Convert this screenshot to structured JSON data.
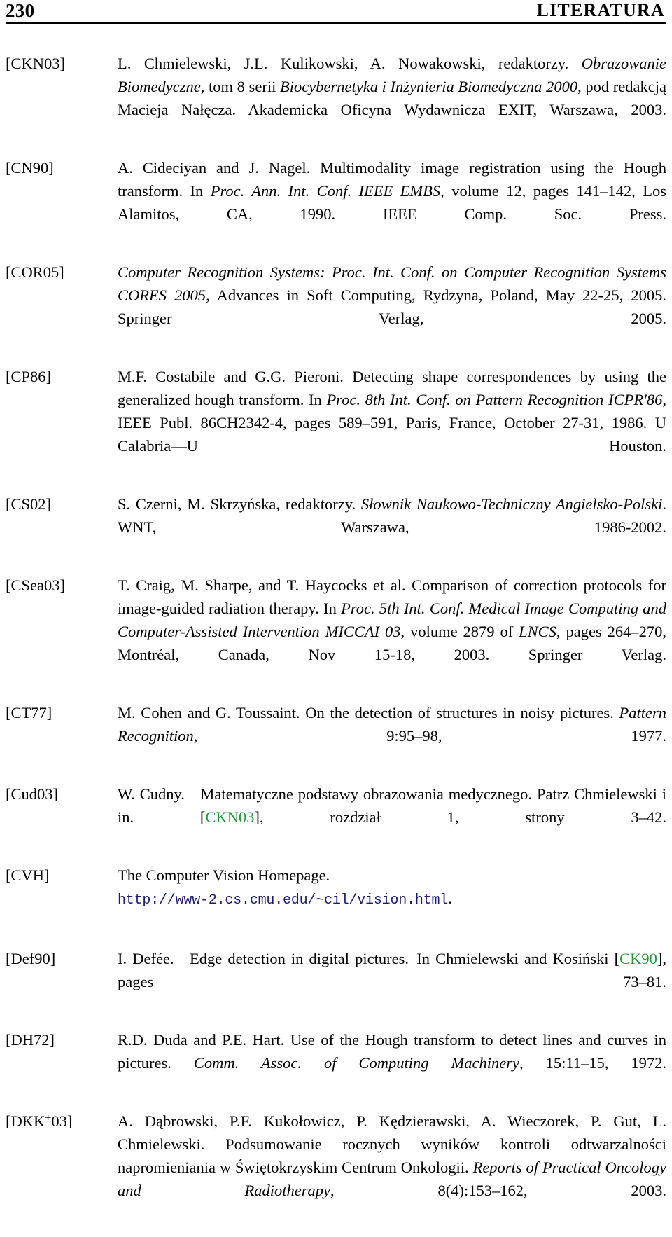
{
  "header": {
    "folio": "230",
    "title": "LITERATURA"
  },
  "colors": {
    "text": "#000000",
    "citation_link": "#1f9b33",
    "url_link": "#1c1c78",
    "rule": "#000000",
    "background": "#ffffff"
  },
  "bibliography": {
    "entries": [
      {
        "label": "[CKN03]",
        "text": "L. Chmielewski, J.L. Kulikowski, A. Nowakowski, redaktorzy. Obrazowanie Biomedyczne, tom 8 serii Biocybernetyka i Inżynieria Biomedyczna 2000, pod redakcją Macieja Nałęcza. Akademicka Oficyna Wydawnicza EXIT, Warszawa, 2003.",
        "parts": [
          {
            "t": "L. Chmielewski, J.L. Kulikowski, A. Nowakowski, redaktorzy. ",
            "s": "roman"
          },
          {
            "t": "Obrazowanie Biomedyczne",
            "s": "italic"
          },
          {
            "t": ", tom 8 serii ",
            "s": "roman"
          },
          {
            "t": "Biocybernetyka i Inżynieria Biomedyczna 2000",
            "s": "italic"
          },
          {
            "t": ", pod redakcją Macieja Nałęcza. Akademicka Oficyna Wydawnicza EXIT, Warszawa, 2003.",
            "s": "roman"
          }
        ]
      },
      {
        "label": "[CN90]",
        "text": "A. Cideciyan and J. Nagel. Multimodality image registration using the Hough transform. In Proc. Ann. Int. Conf. IEEE EMBS, volume 12, pages 141–142, Los Alamitos, CA, 1990. IEEE Comp. Soc. Press.",
        "parts": [
          {
            "t": "A. Cideciyan and J. Nagel. Multimodality image registration using the Hough transform. In ",
            "s": "roman"
          },
          {
            "t": "Proc. Ann. Int. Conf. IEEE EMBS",
            "s": "italic"
          },
          {
            "t": ", volume 12, pages 141–142, Los Alamitos, CA, 1990. IEEE Comp. Soc. Press.",
            "s": "roman"
          }
        ]
      },
      {
        "label": "[COR05]",
        "text": "Computer Recognition Systems: Proc. Int. Conf. on Computer Recognition Systems CORES 2005, Advances in Soft Computing, Rydzyna, Poland, May 22-25, 2005. Springer Verlag, 2005.",
        "parts": [
          {
            "t": "Computer Recognition Systems: Proc. Int. Conf. on Computer Recognition Systems CORES 2005",
            "s": "italic"
          },
          {
            "t": ", Advances in Soft Computing, Rydzyna, Poland, May 22-25, 2005. Springer Verlag, 2005.",
            "s": "roman"
          }
        ]
      },
      {
        "label": "[CP86]",
        "text": "M.F. Costabile and G.G. Pieroni. Detecting shape correspondences by using the generalized hough transform. In Proc. 8th Int. Conf. on Pattern Recognition ICPR'86, IEEE Publ. 86CH2342-4, pages 589–591, Paris, France, October 27-31, 1986. U Calabria—U Houston.",
        "parts": [
          {
            "t": "M.F. Costabile and G.G. Pieroni. Detecting shape correspondences by using the generalized hough transform. In ",
            "s": "roman"
          },
          {
            "t": "Proc. 8th Int. Conf. on Pattern Recognition ICPR'86",
            "s": "italic"
          },
          {
            "t": ", IEEE Publ. 86CH2342-4, pages 589–591, Paris, France, October 27-31, 1986. U Calabria—U Houston.",
            "s": "roman"
          }
        ]
      },
      {
        "label": "[CS02]",
        "text": "S. Czerni, M. Skrzyńska, redaktorzy. Słownik Naukowo-Techniczny Angielsko-Polski. WNT, Warszawa, 1986-2002.",
        "parts": [
          {
            "t": "S. Czerni, M. Skrzyńska, redaktorzy. ",
            "s": "roman"
          },
          {
            "t": "Słownik Naukowo-Techniczny Angielsko-Polski",
            "s": "italic"
          },
          {
            "t": ". WNT, Warszawa, 1986-2002.",
            "s": "roman"
          }
        ]
      },
      {
        "label": "[CSea03]",
        "text": "T. Craig, M. Sharpe, and T. Haycocks et al. Comparison of correction protocols for image-guided radiation therapy. In Proc. 5th Int. Conf. Medical Image Computing and Computer-Assisted Intervention MICCAI 03, volume 2879 of LNCS, pages 264–270, Montréal, Canada, Nov 15-18, 2003. Springer Verlag.",
        "parts": [
          {
            "t": "T. Craig, M. Sharpe, and T. Haycocks et al. Comparison of correction protocols for image-guided radiation therapy. In ",
            "s": "roman"
          },
          {
            "t": "Proc. 5th Int. Conf. Medical Image Computing and Computer-Assisted Intervention MICCAI 03",
            "s": "italic"
          },
          {
            "t": ", volume 2879 of ",
            "s": "roman"
          },
          {
            "t": "LNCS",
            "s": "italic"
          },
          {
            "t": ", pages 264–270, Montréal, Canada, Nov 15-18, 2003. Springer Verlag.",
            "s": "roman"
          }
        ]
      },
      {
        "label": "[CT77]",
        "text": "M. Cohen and G. Toussaint. On the detection of structures in noisy pictures. Pattern Recognition, 9:95–98, 1977.",
        "parts": [
          {
            "t": "M. Cohen and G. Toussaint. On the detection of structures in noisy pictures. ",
            "s": "roman"
          },
          {
            "t": "Pattern Recognition",
            "s": "italic"
          },
          {
            "t": ", 9:95–98, 1977.",
            "s": "roman"
          }
        ]
      },
      {
        "label": "[Cud03]",
        "text": "W. Cudny. Matematyczne podstawy obrazowania medycznego. Patrz Chmielewski i in. [CKN03], rozdział 1, strony 3–42.",
        "parts": [
          {
            "t": "W. Cudny. Matematyczne podstawy obrazowania medycznego. Patrz Chmielewski i in. [",
            "s": "roman"
          },
          {
            "t": "CKN03",
            "s": "cite"
          },
          {
            "t": "], rozdział 1, strony 3–42.",
            "s": "roman"
          }
        ]
      },
      {
        "label": "[CVH]",
        "text": "The Computer Vision Homepage. http://www-2.cs.cmu.edu/~cil/vision.html.",
        "parts": [
          {
            "t": "The Computer Vision Homepage.",
            "s": "roman"
          },
          {
            "t": "BREAK",
            "s": "break"
          },
          {
            "t": "http://www-2.cs.cmu.edu/~cil/vision.html",
            "s": "url"
          },
          {
            "t": ".",
            "s": "roman"
          }
        ]
      },
      {
        "label": "[Def90]",
        "text": "I. Defée. Edge detection in digital pictures. In Chmielewski and Kosiński [CK90], pages 73–81.",
        "parts": [
          {
            "t": "I. Defée. Edge detection in digital pictures. In Chmielewski and Kosiński [",
            "s": "roman"
          },
          {
            "t": "CK90",
            "s": "cite"
          },
          {
            "t": "], pages 73–81.",
            "s": "roman"
          }
        ]
      },
      {
        "label": "[DH72]",
        "text": "R.D. Duda and P.E. Hart. Use of the Hough transform to detect lines and curves in pictures. Comm. Assoc. of Computing Machinery, 15:11–15, 1972.",
        "parts": [
          {
            "t": "R.D. Duda and P.E. Hart. Use of the Hough transform to detect lines and curves in pictures. ",
            "s": "roman"
          },
          {
            "t": "Comm. Assoc. of Computing Machinery",
            "s": "italic"
          },
          {
            "t": ", 15:11–15, 1972.",
            "s": "roman"
          }
        ]
      },
      {
        "label": "[DKK⁺03]",
        "label_base": "[DKK",
        "label_sup": "+",
        "label_tail": "03]",
        "text": "A. Dąbrowski, P.F. Kukołowicz, P. Kędzierawski, A. Wieczorek, P. Gut, L. Chmielewski. Podsumowanie rocznych wyników kontroli odtwarzalności napromieniania w Świętokrzyskim Centrum Onkologii. Reports of Practical Oncology and Radiotherapy, 8(4):153–162, 2003.",
        "parts": [
          {
            "t": "A. Dąbrowski, P.F. Kukołowicz, P. Kędzierawski, A. Wieczorek, P. Gut, L. Chmielewski. Podsumowanie rocznych wyników kontroli odtwarzalności napromieniania w Świętokrzyskim Centrum Onkologii. ",
            "s": "roman"
          },
          {
            "t": "Reports of Practical Oncology and Radiotherapy",
            "s": "italic"
          },
          {
            "t": ", 8(4):153–162, 2003.",
            "s": "roman"
          }
        ]
      }
    ]
  }
}
